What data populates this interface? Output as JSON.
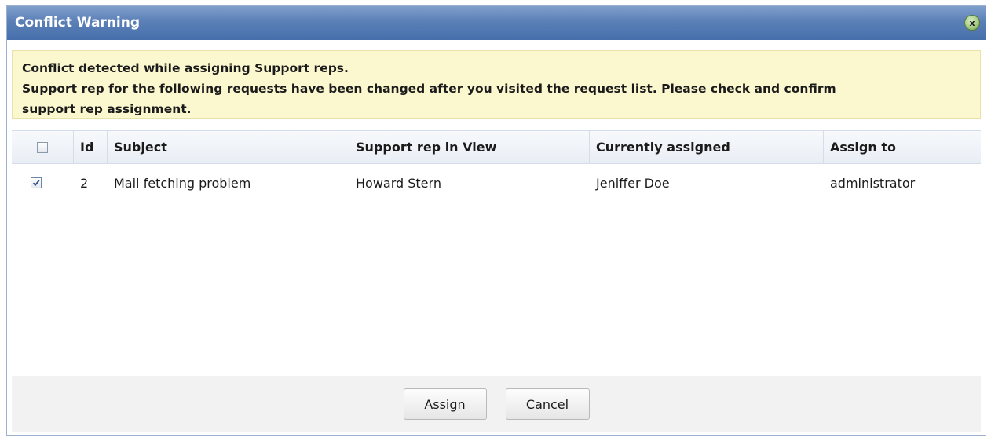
{
  "dialog": {
    "title": "Conflict Warning",
    "close_icon_glyph": "x"
  },
  "warning": {
    "line1": "Conflict detected while assigning Support reps.",
    "line2": "Support rep for the following requests have been changed after you visited the request list. Please check and confirm",
    "line3": "support rep assignment."
  },
  "table": {
    "headers": {
      "select_all_checked": false,
      "id": "Id",
      "subject": "Subject",
      "support_rep_in_view": "Support rep in View",
      "currently_assigned": "Currently assigned",
      "assign_to": "Assign to"
    },
    "rows": [
      {
        "checked": true,
        "id": "2",
        "subject": "Mail fetching problem",
        "support_rep_in_view": "Howard Stern",
        "currently_assigned": "Jeniffer Doe",
        "assign_to": "administrator"
      }
    ]
  },
  "footer": {
    "assign_label": "Assign",
    "cancel_label": "Cancel"
  },
  "colors": {
    "title_bar": "#5b80b7",
    "warning_bg": "#fbf7cf",
    "footer_bg": "#f2f2f2"
  }
}
